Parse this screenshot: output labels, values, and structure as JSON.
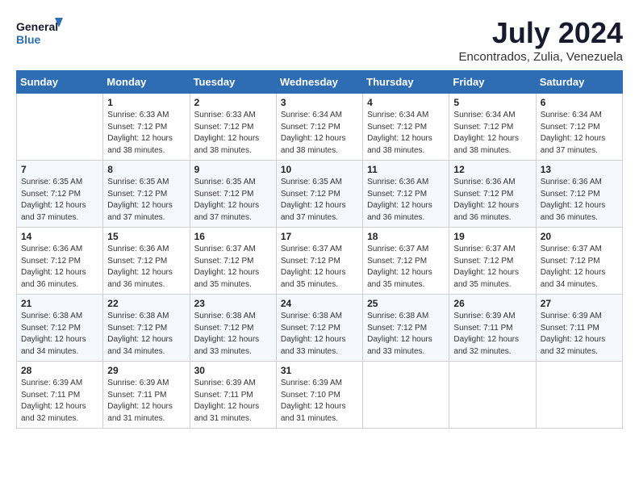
{
  "header": {
    "logo_line1": "General",
    "logo_line2": "Blue",
    "month_year": "July 2024",
    "location": "Encontrados, Zulia, Venezuela"
  },
  "weekdays": [
    "Sunday",
    "Monday",
    "Tuesday",
    "Wednesday",
    "Thursday",
    "Friday",
    "Saturday"
  ],
  "weeks": [
    [
      {
        "day": "",
        "content": ""
      },
      {
        "day": "1",
        "content": "Sunrise: 6:33 AM\nSunset: 7:12 PM\nDaylight: 12 hours\nand 38 minutes."
      },
      {
        "day": "2",
        "content": "Sunrise: 6:33 AM\nSunset: 7:12 PM\nDaylight: 12 hours\nand 38 minutes."
      },
      {
        "day": "3",
        "content": "Sunrise: 6:34 AM\nSunset: 7:12 PM\nDaylight: 12 hours\nand 38 minutes."
      },
      {
        "day": "4",
        "content": "Sunrise: 6:34 AM\nSunset: 7:12 PM\nDaylight: 12 hours\nand 38 minutes."
      },
      {
        "day": "5",
        "content": "Sunrise: 6:34 AM\nSunset: 7:12 PM\nDaylight: 12 hours\nand 38 minutes."
      },
      {
        "day": "6",
        "content": "Sunrise: 6:34 AM\nSunset: 7:12 PM\nDaylight: 12 hours\nand 37 minutes."
      }
    ],
    [
      {
        "day": "7",
        "content": "Sunrise: 6:35 AM\nSunset: 7:12 PM\nDaylight: 12 hours\nand 37 minutes."
      },
      {
        "day": "8",
        "content": "Sunrise: 6:35 AM\nSunset: 7:12 PM\nDaylight: 12 hours\nand 37 minutes."
      },
      {
        "day": "9",
        "content": "Sunrise: 6:35 AM\nSunset: 7:12 PM\nDaylight: 12 hours\nand 37 minutes."
      },
      {
        "day": "10",
        "content": "Sunrise: 6:35 AM\nSunset: 7:12 PM\nDaylight: 12 hours\nand 37 minutes."
      },
      {
        "day": "11",
        "content": "Sunrise: 6:36 AM\nSunset: 7:12 PM\nDaylight: 12 hours\nand 36 minutes."
      },
      {
        "day": "12",
        "content": "Sunrise: 6:36 AM\nSunset: 7:12 PM\nDaylight: 12 hours\nand 36 minutes."
      },
      {
        "day": "13",
        "content": "Sunrise: 6:36 AM\nSunset: 7:12 PM\nDaylight: 12 hours\nand 36 minutes."
      }
    ],
    [
      {
        "day": "14",
        "content": "Sunrise: 6:36 AM\nSunset: 7:12 PM\nDaylight: 12 hours\nand 36 minutes."
      },
      {
        "day": "15",
        "content": "Sunrise: 6:36 AM\nSunset: 7:12 PM\nDaylight: 12 hours\nand 36 minutes."
      },
      {
        "day": "16",
        "content": "Sunrise: 6:37 AM\nSunset: 7:12 PM\nDaylight: 12 hours\nand 35 minutes."
      },
      {
        "day": "17",
        "content": "Sunrise: 6:37 AM\nSunset: 7:12 PM\nDaylight: 12 hours\nand 35 minutes."
      },
      {
        "day": "18",
        "content": "Sunrise: 6:37 AM\nSunset: 7:12 PM\nDaylight: 12 hours\nand 35 minutes."
      },
      {
        "day": "19",
        "content": "Sunrise: 6:37 AM\nSunset: 7:12 PM\nDaylight: 12 hours\nand 35 minutes."
      },
      {
        "day": "20",
        "content": "Sunrise: 6:37 AM\nSunset: 7:12 PM\nDaylight: 12 hours\nand 34 minutes."
      }
    ],
    [
      {
        "day": "21",
        "content": "Sunrise: 6:38 AM\nSunset: 7:12 PM\nDaylight: 12 hours\nand 34 minutes."
      },
      {
        "day": "22",
        "content": "Sunrise: 6:38 AM\nSunset: 7:12 PM\nDaylight: 12 hours\nand 34 minutes."
      },
      {
        "day": "23",
        "content": "Sunrise: 6:38 AM\nSunset: 7:12 PM\nDaylight: 12 hours\nand 33 minutes."
      },
      {
        "day": "24",
        "content": "Sunrise: 6:38 AM\nSunset: 7:12 PM\nDaylight: 12 hours\nand 33 minutes."
      },
      {
        "day": "25",
        "content": "Sunrise: 6:38 AM\nSunset: 7:12 PM\nDaylight: 12 hours\nand 33 minutes."
      },
      {
        "day": "26",
        "content": "Sunrise: 6:39 AM\nSunset: 7:11 PM\nDaylight: 12 hours\nand 32 minutes."
      },
      {
        "day": "27",
        "content": "Sunrise: 6:39 AM\nSunset: 7:11 PM\nDaylight: 12 hours\nand 32 minutes."
      }
    ],
    [
      {
        "day": "28",
        "content": "Sunrise: 6:39 AM\nSunset: 7:11 PM\nDaylight: 12 hours\nand 32 minutes."
      },
      {
        "day": "29",
        "content": "Sunrise: 6:39 AM\nSunset: 7:11 PM\nDaylight: 12 hours\nand 31 minutes."
      },
      {
        "day": "30",
        "content": "Sunrise: 6:39 AM\nSunset: 7:11 PM\nDaylight: 12 hours\nand 31 minutes."
      },
      {
        "day": "31",
        "content": "Sunrise: 6:39 AM\nSunset: 7:10 PM\nDaylight: 12 hours\nand 31 minutes."
      },
      {
        "day": "",
        "content": ""
      },
      {
        "day": "",
        "content": ""
      },
      {
        "day": "",
        "content": ""
      }
    ]
  ]
}
